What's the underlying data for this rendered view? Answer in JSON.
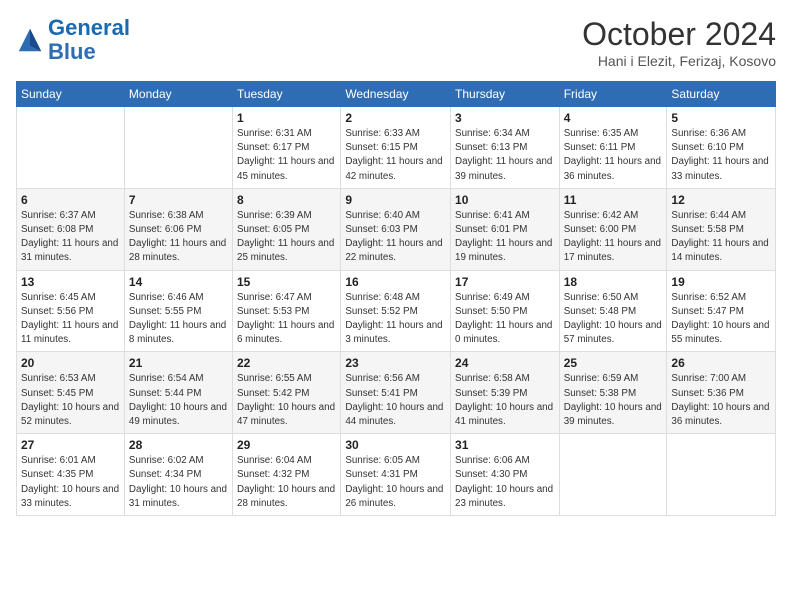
{
  "header": {
    "logo_general": "General",
    "logo_blue": "Blue",
    "month_title": "October 2024",
    "location": "Hani i Elezit, Ferizaj, Kosovo"
  },
  "weekdays": [
    "Sunday",
    "Monday",
    "Tuesday",
    "Wednesday",
    "Thursday",
    "Friday",
    "Saturday"
  ],
  "weeks": [
    [
      {
        "day": "",
        "sunrise": "",
        "sunset": "",
        "daylight": ""
      },
      {
        "day": "",
        "sunrise": "",
        "sunset": "",
        "daylight": ""
      },
      {
        "day": "1",
        "sunrise": "Sunrise: 6:31 AM",
        "sunset": "Sunset: 6:17 PM",
        "daylight": "Daylight: 11 hours and 45 minutes."
      },
      {
        "day": "2",
        "sunrise": "Sunrise: 6:33 AM",
        "sunset": "Sunset: 6:15 PM",
        "daylight": "Daylight: 11 hours and 42 minutes."
      },
      {
        "day": "3",
        "sunrise": "Sunrise: 6:34 AM",
        "sunset": "Sunset: 6:13 PM",
        "daylight": "Daylight: 11 hours and 39 minutes."
      },
      {
        "day": "4",
        "sunrise": "Sunrise: 6:35 AM",
        "sunset": "Sunset: 6:11 PM",
        "daylight": "Daylight: 11 hours and 36 minutes."
      },
      {
        "day": "5",
        "sunrise": "Sunrise: 6:36 AM",
        "sunset": "Sunset: 6:10 PM",
        "daylight": "Daylight: 11 hours and 33 minutes."
      }
    ],
    [
      {
        "day": "6",
        "sunrise": "Sunrise: 6:37 AM",
        "sunset": "Sunset: 6:08 PM",
        "daylight": "Daylight: 11 hours and 31 minutes."
      },
      {
        "day": "7",
        "sunrise": "Sunrise: 6:38 AM",
        "sunset": "Sunset: 6:06 PM",
        "daylight": "Daylight: 11 hours and 28 minutes."
      },
      {
        "day": "8",
        "sunrise": "Sunrise: 6:39 AM",
        "sunset": "Sunset: 6:05 PM",
        "daylight": "Daylight: 11 hours and 25 minutes."
      },
      {
        "day": "9",
        "sunrise": "Sunrise: 6:40 AM",
        "sunset": "Sunset: 6:03 PM",
        "daylight": "Daylight: 11 hours and 22 minutes."
      },
      {
        "day": "10",
        "sunrise": "Sunrise: 6:41 AM",
        "sunset": "Sunset: 6:01 PM",
        "daylight": "Daylight: 11 hours and 19 minutes."
      },
      {
        "day": "11",
        "sunrise": "Sunrise: 6:42 AM",
        "sunset": "Sunset: 6:00 PM",
        "daylight": "Daylight: 11 hours and 17 minutes."
      },
      {
        "day": "12",
        "sunrise": "Sunrise: 6:44 AM",
        "sunset": "Sunset: 5:58 PM",
        "daylight": "Daylight: 11 hours and 14 minutes."
      }
    ],
    [
      {
        "day": "13",
        "sunrise": "Sunrise: 6:45 AM",
        "sunset": "Sunset: 5:56 PM",
        "daylight": "Daylight: 11 hours and 11 minutes."
      },
      {
        "day": "14",
        "sunrise": "Sunrise: 6:46 AM",
        "sunset": "Sunset: 5:55 PM",
        "daylight": "Daylight: 11 hours and 8 minutes."
      },
      {
        "day": "15",
        "sunrise": "Sunrise: 6:47 AM",
        "sunset": "Sunset: 5:53 PM",
        "daylight": "Daylight: 11 hours and 6 minutes."
      },
      {
        "day": "16",
        "sunrise": "Sunrise: 6:48 AM",
        "sunset": "Sunset: 5:52 PM",
        "daylight": "Daylight: 11 hours and 3 minutes."
      },
      {
        "day": "17",
        "sunrise": "Sunrise: 6:49 AM",
        "sunset": "Sunset: 5:50 PM",
        "daylight": "Daylight: 11 hours and 0 minutes."
      },
      {
        "day": "18",
        "sunrise": "Sunrise: 6:50 AM",
        "sunset": "Sunset: 5:48 PM",
        "daylight": "Daylight: 10 hours and 57 minutes."
      },
      {
        "day": "19",
        "sunrise": "Sunrise: 6:52 AM",
        "sunset": "Sunset: 5:47 PM",
        "daylight": "Daylight: 10 hours and 55 minutes."
      }
    ],
    [
      {
        "day": "20",
        "sunrise": "Sunrise: 6:53 AM",
        "sunset": "Sunset: 5:45 PM",
        "daylight": "Daylight: 10 hours and 52 minutes."
      },
      {
        "day": "21",
        "sunrise": "Sunrise: 6:54 AM",
        "sunset": "Sunset: 5:44 PM",
        "daylight": "Daylight: 10 hours and 49 minutes."
      },
      {
        "day": "22",
        "sunrise": "Sunrise: 6:55 AM",
        "sunset": "Sunset: 5:42 PM",
        "daylight": "Daylight: 10 hours and 47 minutes."
      },
      {
        "day": "23",
        "sunrise": "Sunrise: 6:56 AM",
        "sunset": "Sunset: 5:41 PM",
        "daylight": "Daylight: 10 hours and 44 minutes."
      },
      {
        "day": "24",
        "sunrise": "Sunrise: 6:58 AM",
        "sunset": "Sunset: 5:39 PM",
        "daylight": "Daylight: 10 hours and 41 minutes."
      },
      {
        "day": "25",
        "sunrise": "Sunrise: 6:59 AM",
        "sunset": "Sunset: 5:38 PM",
        "daylight": "Daylight: 10 hours and 39 minutes."
      },
      {
        "day": "26",
        "sunrise": "Sunrise: 7:00 AM",
        "sunset": "Sunset: 5:36 PM",
        "daylight": "Daylight: 10 hours and 36 minutes."
      }
    ],
    [
      {
        "day": "27",
        "sunrise": "Sunrise: 6:01 AM",
        "sunset": "Sunset: 4:35 PM",
        "daylight": "Daylight: 10 hours and 33 minutes."
      },
      {
        "day": "28",
        "sunrise": "Sunrise: 6:02 AM",
        "sunset": "Sunset: 4:34 PM",
        "daylight": "Daylight: 10 hours and 31 minutes."
      },
      {
        "day": "29",
        "sunrise": "Sunrise: 6:04 AM",
        "sunset": "Sunset: 4:32 PM",
        "daylight": "Daylight: 10 hours and 28 minutes."
      },
      {
        "day": "30",
        "sunrise": "Sunrise: 6:05 AM",
        "sunset": "Sunset: 4:31 PM",
        "daylight": "Daylight: 10 hours and 26 minutes."
      },
      {
        "day": "31",
        "sunrise": "Sunrise: 6:06 AM",
        "sunset": "Sunset: 4:30 PM",
        "daylight": "Daylight: 10 hours and 23 minutes."
      },
      {
        "day": "",
        "sunrise": "",
        "sunset": "",
        "daylight": ""
      },
      {
        "day": "",
        "sunrise": "",
        "sunset": "",
        "daylight": ""
      }
    ]
  ]
}
